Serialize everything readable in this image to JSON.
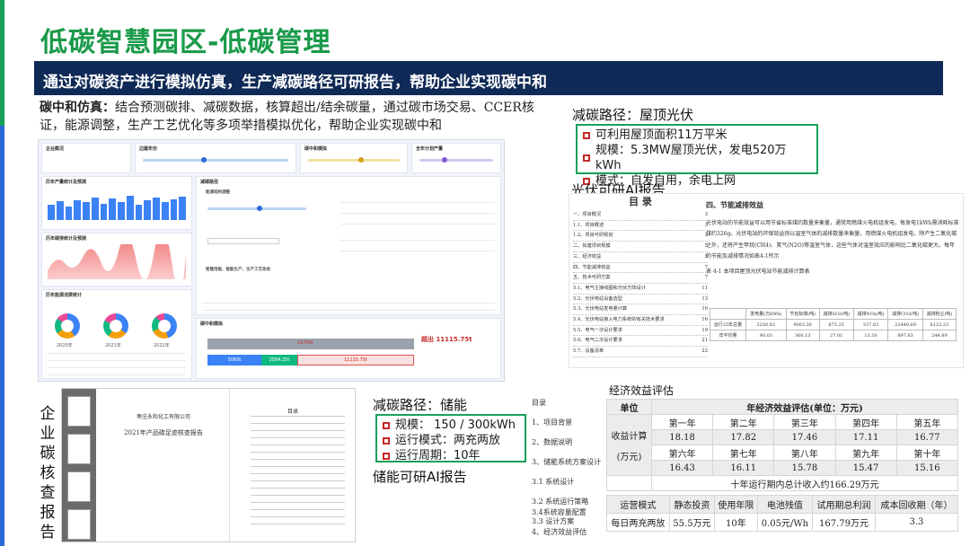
{
  "page": {
    "title": "低碳智慧园区-低碳管理",
    "subtitle": "通过对碳资产进行模拟仿真，生产减碳路径可研报告，帮助企业实现碳中和",
    "intro_label": "碳中和仿真：",
    "intro_text": "结合预测碳排、减碳数据，核算超出/结余碳量，通过碳市场交易、CCER核证，能源调整，生产工艺优化等多项举措模拟优化，帮助企业实现碳中和"
  },
  "colors": {
    "brand_green": "#1aa05a",
    "banner_navy": "#0f2a56",
    "bullet_red": "#c62828"
  },
  "dashboard": {
    "panel_enterprise": "企业概况",
    "panel_slider": "边履年份",
    "panel_deduct": "碳中和模拟",
    "panel_plan": "全年计划产量",
    "panel_history_output": "历年产量统计及预测",
    "panel_history_carbon": "历年碳排统计及预测",
    "panel_path": "减碳路径",
    "panel_path_sub": "能源结构调整",
    "panel_smart": "智慧用能、智能生产、生产工艺改进",
    "panel_consumption": "历年能源消费统计",
    "panel_sim": "碳中和模拟",
    "years": [
      "2020年",
      "2021年",
      "2022年"
    ],
    "sim_over": "超出",
    "sim_over_value": "11115.75t",
    "sim_value_a": "5060t",
    "sim_value_b": "2584.25t",
    "sim_value_c": "11115.75t",
    "sim_value_d": "10750t"
  },
  "rooftop": {
    "heading": "减碳路径：屋顶光伏",
    "items": [
      "可利用屋顶面积11万平米",
      "规模：5.3MW屋顶光伏，发电520万kWh",
      "模式：自发自用，余电上网"
    ]
  },
  "pv_report": {
    "heading": "光伏可研AI报告",
    "toc_title": "目  录",
    "toc_items": [
      {
        "t": "一、项目概况",
        "p": "3"
      },
      {
        "t": "1.1、项目概述",
        "p": "3"
      },
      {
        "t": "1.2、项目可研规划",
        "p": "3"
      },
      {
        "t": "二、拟建项目规模",
        "p": "5"
      },
      {
        "t": "三、经济效益",
        "p": "5"
      },
      {
        "t": "四、节能减排效益",
        "p": "7"
      },
      {
        "t": "五、技术可研方案",
        "p": "7"
      },
      {
        "t": "5.1、电气主接线图和光伏方阵设计",
        "p": "11"
      },
      {
        "t": "5.2、光伏电站设备选型",
        "p": "13"
      },
      {
        "t": "5.3、光伏电站发电量计算",
        "p": "16"
      },
      {
        "t": "5.4、光伏电站接入电力系统的有关技术要求",
        "p": "16"
      },
      {
        "t": "5.5、电气一次设计要求",
        "p": "19"
      },
      {
        "t": "5.6、电气二次设计要求",
        "p": "21"
      },
      {
        "t": "5.7、设备清单",
        "p": "22"
      }
    ],
    "section_title": "四、节能减排效益",
    "para": "光伏电站的节能效益可以用节省标准煤的数量来衡量，通常用燃煤火电机组发电，每发电1kWh需消耗标准煤约326g。光伏电站的环保效益则以温室气体的减排数量来衡量，用燃煤火电机组发电，除产生二氧化碳之外，还将产生甲烷(CH4)、笑气(N2O)等温室气体，这些气体对温室效应的影响比二氧化碳更大。每年的节能及减排情况如表4-1所示",
    "table_caption": "表 4-1  本项目屋顶光伏电站节能减排计算表",
    "table_header": [
      "",
      "发电量(万kWh)",
      "节省标煤(吨)",
      "减排SO2(吨)",
      "减排NOx(吨)",
      "减排CO2(吨)",
      "减排粉尘(吨)"
    ],
    "table_rows": [
      [
        "运行25年总量",
        "2250.62",
        "9003.26",
        "675.25",
        "337.62",
        "22440.69",
        "6122.23"
      ],
      [
        "年平均量",
        "90.03",
        "360.13",
        "27.01",
        "13.50",
        "897.63",
        "244.89"
      ]
    ]
  },
  "verification": {
    "label": "企业碳核查报告",
    "company": "枣庄永和化工有限公司",
    "report_title": "2021年产品碳足迹核查报告",
    "toc": "目录"
  },
  "storage": {
    "heading": "减碳路径：储能",
    "items": [
      "规模： 150 / 300kWh",
      "运行模式：两充两放",
      "运行周期：10年"
    ],
    "report_heading": "储能可研AI报告",
    "toc_items": [
      "目录",
      "1、项目背景",
      "2、数据说明",
      "3、储能系统方案设计",
      "3.1 系统设计",
      "3.2 系统运行策略",
      "3.3 设计方案",
      "3.4系统容量配置",
      "4、经济效益评估"
    ]
  },
  "economics": {
    "title": "经济效益评估",
    "unit_label": "单位",
    "header": "年经济效益评估(单位：万元)",
    "row_label_1": "收益计算",
    "row_label_2": "(万元)",
    "years_a": [
      "第一年",
      "第二年",
      "第三年",
      "第四年",
      "第五年"
    ],
    "values_a": [
      "18.18",
      "17.82",
      "17.46",
      "17.11",
      "16.77"
    ],
    "years_b": [
      "第六年",
      "第七年",
      "第八年",
      "第九年",
      "第十年"
    ],
    "values_b": [
      "16.43",
      "16.11",
      "15.78",
      "15.47",
      "15.16"
    ],
    "total": "十年运行期内总计收入约166.29万元",
    "summary_header": [
      "运营模式",
      "静态投资",
      "使用年限",
      "电池残值",
      "试用期总利润",
      "成本回收期（年）"
    ],
    "summary_row": [
      "每日两充两放",
      "55.5万元",
      "10年",
      "0.05元/Wh",
      "167.79万元",
      "3.3"
    ]
  }
}
